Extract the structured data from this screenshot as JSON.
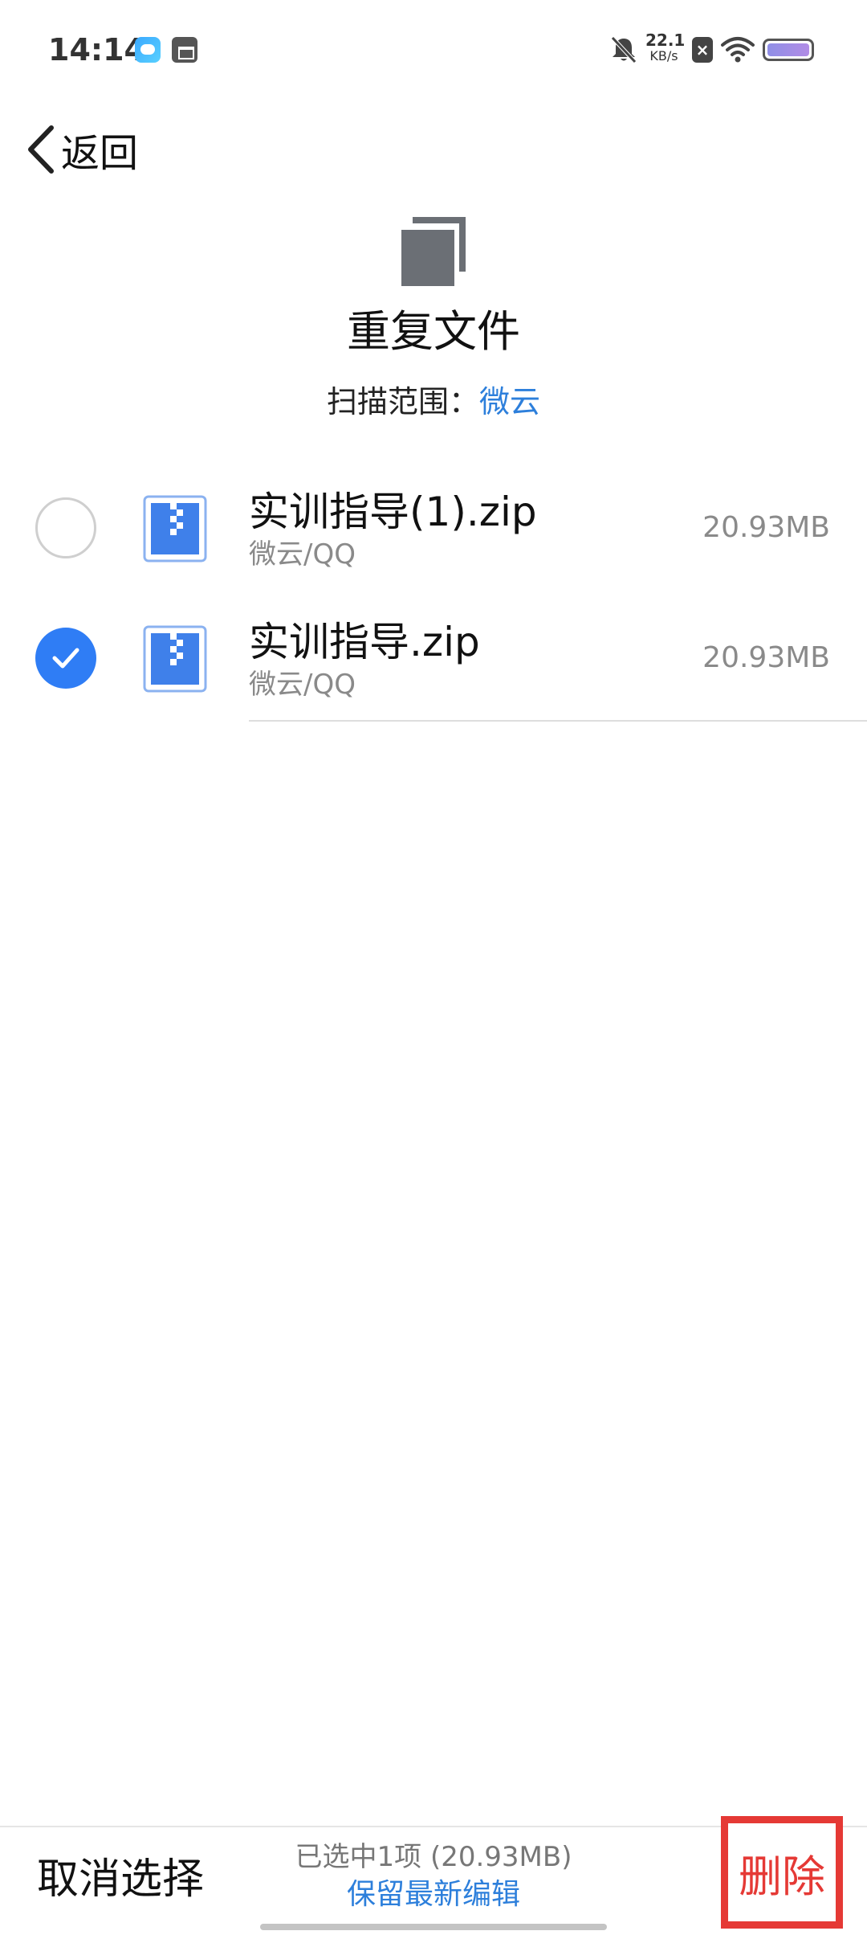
{
  "status_bar": {
    "time": "14:14",
    "net_speed_value": "22.1",
    "net_speed_unit": "KB/s",
    "sim_badge": "×",
    "icons": [
      "cloud-app-icon",
      "calendar-app-icon",
      "bell-off-icon",
      "sim-off-icon",
      "wifi-icon",
      "battery-icon"
    ]
  },
  "nav": {
    "back_label": "返回"
  },
  "header": {
    "title": "重复文件",
    "scan_scope_label": "扫描范围：",
    "scan_scope_value": "微云"
  },
  "files": [
    {
      "name": "实训指导(1).zip",
      "path": "微云/QQ",
      "size": "20.93MB",
      "selected": false
    },
    {
      "name": "实训指导.zip",
      "path": "微云/QQ",
      "size": "20.93MB",
      "selected": true
    }
  ],
  "bottom_bar": {
    "cancel_label": "取消选择",
    "selection_summary": "已选中1项 (20.93MB)",
    "keep_latest_label": "保留最新编辑",
    "delete_label": "删除"
  },
  "colors": {
    "accent_blue": "#2f7df5",
    "link_blue": "#2d7fdb",
    "delete_red": "#e53935",
    "secondary_text": "#8a8a8a"
  }
}
